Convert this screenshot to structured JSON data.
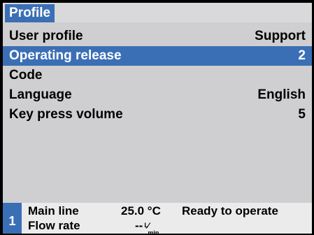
{
  "header": {
    "title": "Profile"
  },
  "menu": {
    "items": [
      {
        "label": "User profile",
        "value": "Support"
      },
      {
        "label": "Operating release",
        "value": "2"
      },
      {
        "label": "Code",
        "value": ""
      },
      {
        "label": "Language",
        "value": "English"
      },
      {
        "label": "Key press volume",
        "value": "5"
      }
    ],
    "selected_index": 1
  },
  "status": {
    "channel": "1",
    "line1_label": "Main line",
    "line1_value": "25.0 °C",
    "line2_label": "Flow rate",
    "line2_value": "--",
    "line2_unit_top": "L",
    "line2_unit_bottom": "min",
    "state": "Ready to operate"
  },
  "colors": {
    "accent": "#3b6fb5",
    "background": "#cfcfd1",
    "statusbar": "#ebebec"
  }
}
